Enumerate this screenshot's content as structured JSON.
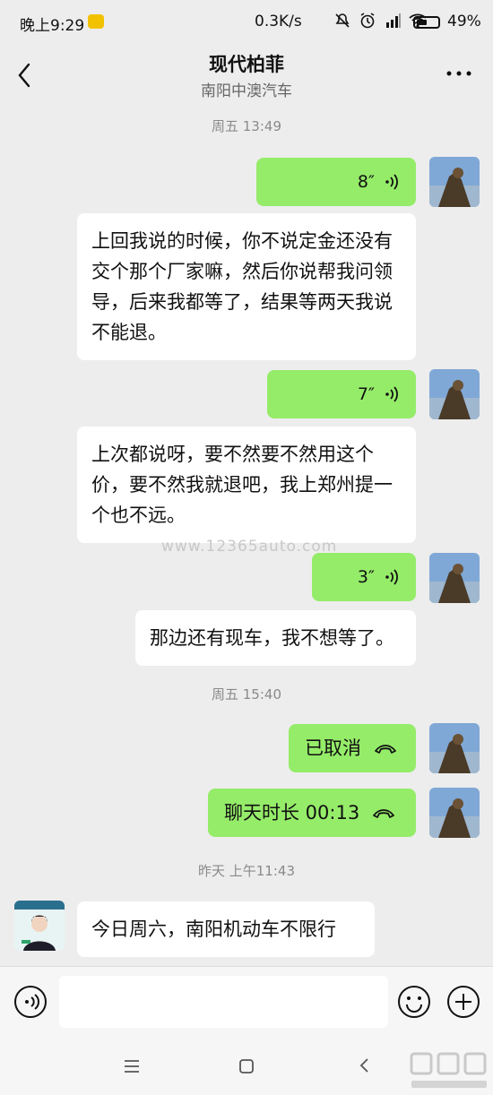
{
  "status_bar": {
    "time": "晚上9:29",
    "network_speed": "0.3K/s",
    "battery_text": "49%",
    "battery_level": 0.49,
    "icons": [
      "app-notification-icon",
      "mute-icon",
      "alarm-icon",
      "hd-signal-icon",
      "wifi-icon",
      "battery-icon"
    ]
  },
  "header": {
    "title": "现代柏菲",
    "subtitle": "南阳中澳汽车"
  },
  "messages": {
    "ts1": "周五 13:49",
    "m1_duration": "8″",
    "m2_text": "上回我说的时候，你不说定金还没有交个那个厂家嘛，然后你说帮我问领导，后来我都等了，结果等两天我说不能退。",
    "m3_duration": "7″",
    "m4_text": "上次都说呀，要不然要不然用这个价，要不然我就退吧，我上郑州提一个也不远。",
    "m5_duration": "3″",
    "m6_text": "那边还有现车，我不想等了。",
    "ts2": "周五 15:40",
    "m7_text": "已取消",
    "m8_text": "聊天时长 00:13",
    "ts3": "昨天 上午11:43",
    "m9_text": "今日周六，南阳机动车不限行"
  },
  "watermark": "www.12365auto.com",
  "input": {
    "placeholder": ""
  },
  "colors": {
    "outgoing_bubble": "#95ec69",
    "incoming_bubble": "#ffffff",
    "background": "#ededed"
  }
}
